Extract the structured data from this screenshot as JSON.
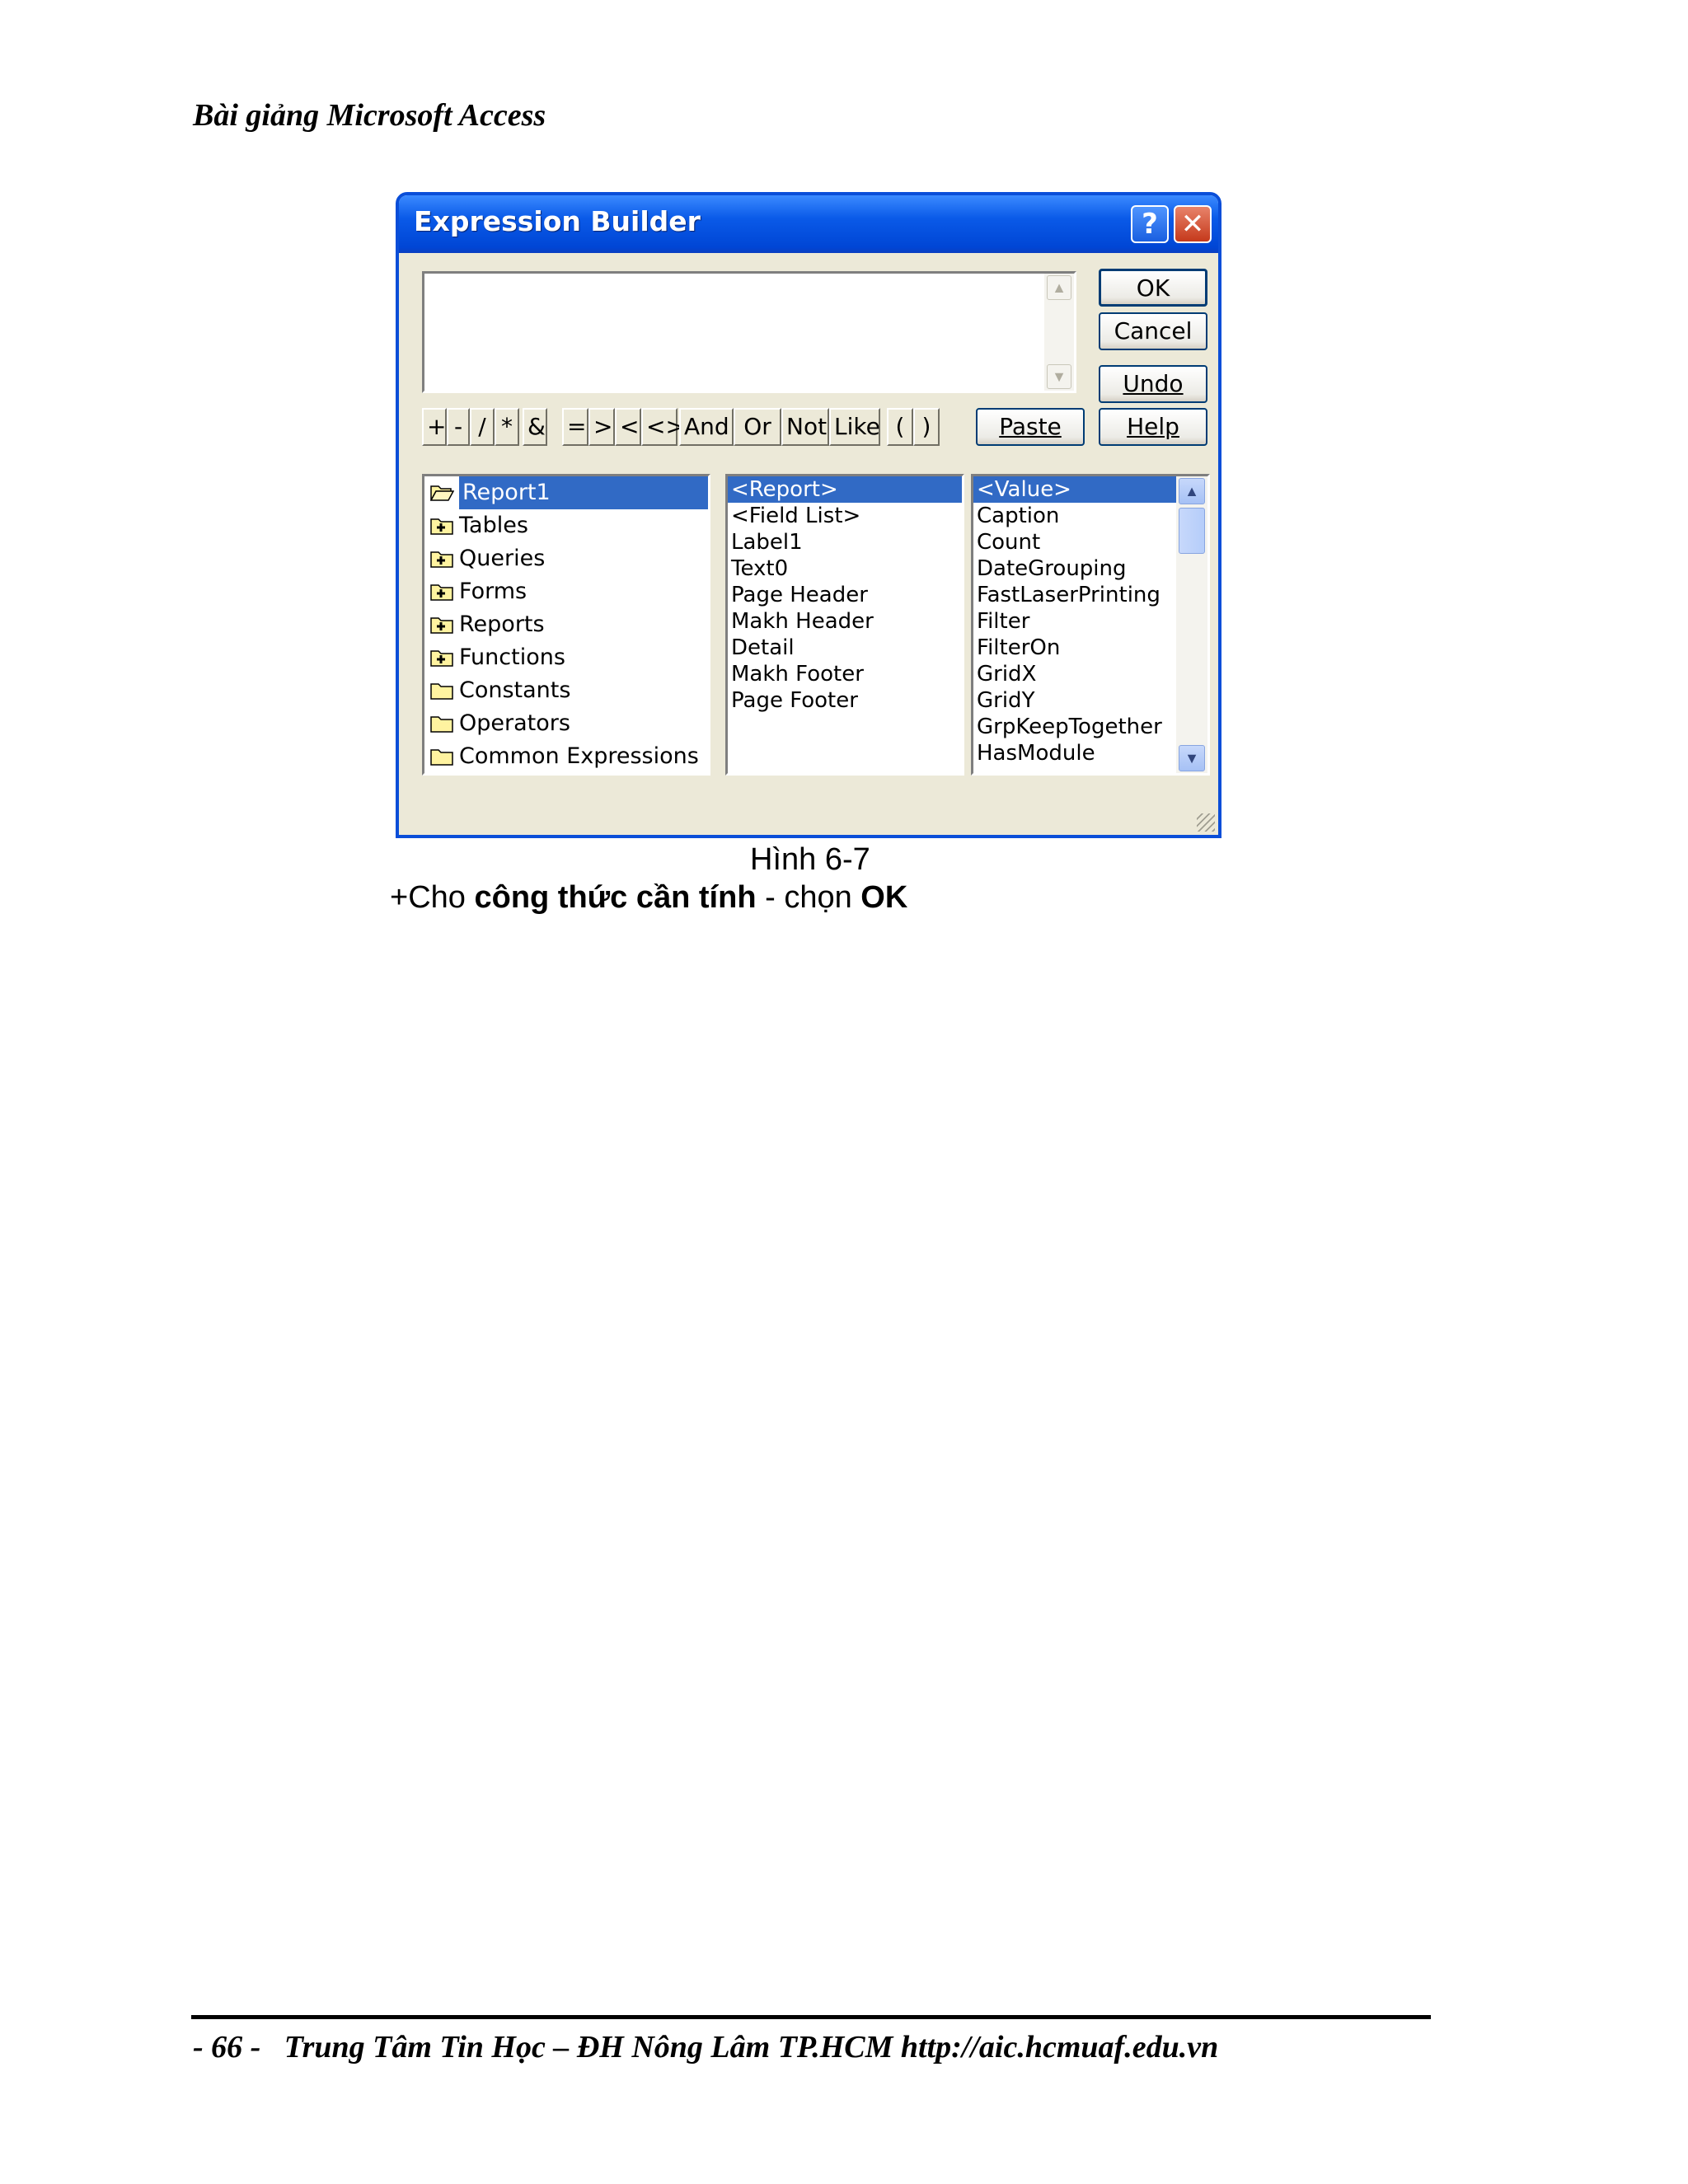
{
  "header": {
    "title": "Bài giảng Microsoft Access"
  },
  "dialog": {
    "title": "Expression Builder",
    "help_glyph": "?",
    "close_glyph": "✕",
    "expression_value": "",
    "buttons": {
      "ok": "OK",
      "cancel": "Cancel",
      "undo": "Undo",
      "help": "Help",
      "paste": "Paste"
    },
    "operators": [
      "+",
      "-",
      "/",
      "*",
      "&",
      "=",
      ">",
      "<",
      "<>",
      "And",
      "Or",
      "Not",
      "Like",
      "(",
      ")"
    ],
    "tree": [
      "Report1",
      "Tables",
      "Queries",
      "Forms",
      "Reports",
      "Functions",
      "Constants",
      "Operators",
      "Common Expressions"
    ],
    "objects": [
      "<Report>",
      "<Field List>",
      "Label1",
      "Text0",
      "Page Header",
      "Makh Header",
      "Detail",
      "Makh Footer",
      "Page Footer"
    ],
    "properties": [
      "<Value>",
      "Caption",
      "Count",
      "DateGrouping",
      "FastLaserPrinting",
      "Filter",
      "FilterOn",
      "GridX",
      "GridY",
      "GrpKeepTogether",
      "HasModule"
    ]
  },
  "figure": {
    "caption": "Hình 6-7"
  },
  "instruction": {
    "prefix": "+Cho ",
    "bold1": "công thức cần tính",
    "middle": " - chọn ",
    "bold2": "OK"
  },
  "footer": {
    "text": "- 66 -   Trung Tâm Tin Học – ĐH Nông Lâm TP.HCM http://aic.hcmuaf.edu.vn"
  }
}
